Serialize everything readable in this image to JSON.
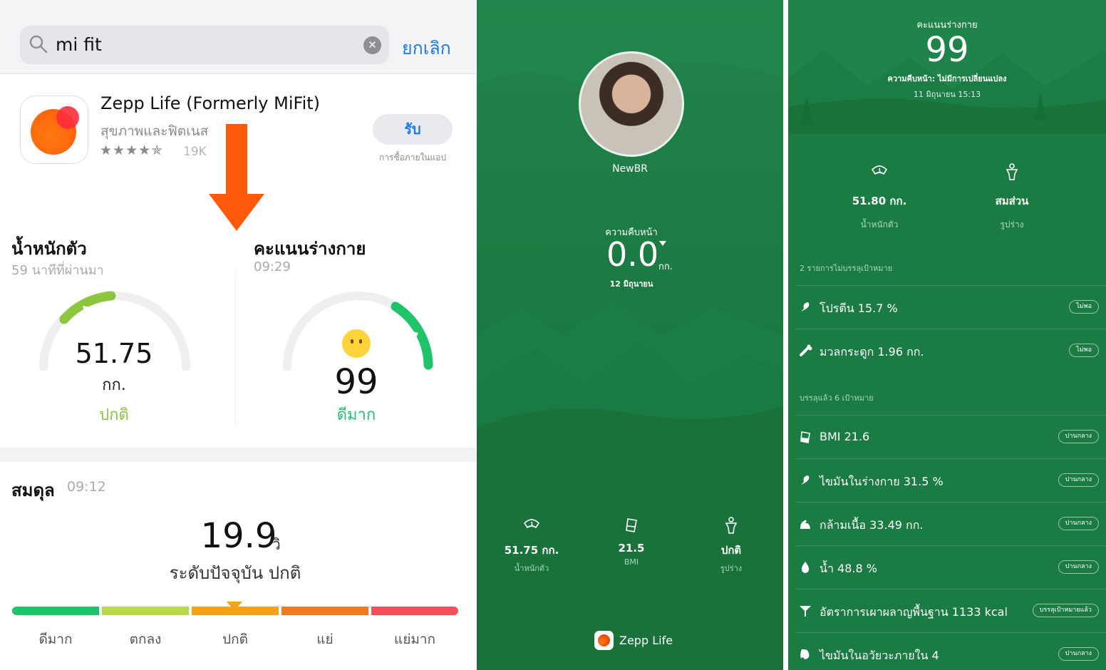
{
  "panel1": {
    "search": {
      "query": "mi fit",
      "cancel_label": "ยกเลิก"
    },
    "app": {
      "name": "Zepp Life (Formerly MiFit)",
      "category": "สุขภาพและฟิตเนส",
      "stars": "★★★★✯",
      "rating_count": "19K",
      "get_label": "รับ",
      "iap_note": "การซื้อภายในแอป",
      "rating_stars_value": 4.5
    },
    "weight_card": {
      "title": "น้ำหนักตัว",
      "time": "59 นาทีที่ผ่านมา",
      "value": "51.75",
      "unit": "กก.",
      "status": "ปกติ"
    },
    "score_card": {
      "title": "คะแนนร่างกาย",
      "time": "09:29",
      "value": "99",
      "status": "ดีมาก"
    },
    "balance": {
      "title": "สมดุล",
      "time": "09:12",
      "value": "19.9",
      "unit": "วิ",
      "level_text": "ระดับปัจจุบัน ปกติ",
      "scale_labels": [
        "ดีมาก",
        "ตกลง",
        "ปกติ",
        "แย่",
        "แย่มาก"
      ],
      "scale_colors": [
        "#1ec36a",
        "#b8d94a",
        "#f5a11c",
        "#f47a20",
        "#f2505a"
      ],
      "current_index": 2
    }
  },
  "panel2": {
    "username": "NewBR",
    "progress_label": "ความคืบหน้า",
    "progress_value": "0.0",
    "progress_unit": "กก.",
    "progress_date": "12 มิถุนายน",
    "stats": [
      {
        "value": "51.75 กก.",
        "label": "น้ำหนักตัว",
        "icon": "scale-icon"
      },
      {
        "value": "21.5",
        "label": "BMI",
        "icon": "bmi-icon"
      },
      {
        "value": "ปกติ",
        "label": "รูปร่าง",
        "icon": "body-icon"
      }
    ],
    "brand": "Zepp Life"
  },
  "panel3": {
    "score_label": "คะแนนร่างกาย",
    "score": "99",
    "progress_text": "ความคืบหน้า: ไม่มีการเปลี่ยนแปลง",
    "date": "11 มิถุนายน 15:13",
    "stats": [
      {
        "value": "51.80 กก.",
        "label": "น้ำหนักตัว",
        "icon": "scale-icon"
      },
      {
        "value": "สมส่วน",
        "label": "รูปร่าง",
        "icon": "body-icon"
      }
    ],
    "section_unmet": "2 รายการไม่บรรลุเป้าหมาย",
    "section_met": "บรรลุแล้ว 6 เป้าหมาย",
    "unmet_rows": [
      {
        "text": "โปรตีน 15.7 %",
        "tag": "ไม่พอ",
        "icon": "protein-icon"
      },
      {
        "text": "มวลกระดูก 1.96 กก.",
        "tag": "ไม่พอ",
        "icon": "bone-icon"
      }
    ],
    "met_rows": [
      {
        "text": "BMI 21.6",
        "tag": "ปานกลาง",
        "icon": "bmi-icon"
      },
      {
        "text": "ไขมันในร่างกาย 31.5 %",
        "tag": "ปานกลาง",
        "icon": "fat-icon"
      },
      {
        "text": "กล้ามเนื้อ 33.49 กก.",
        "tag": "ปานกลาง",
        "icon": "muscle-icon"
      },
      {
        "text": "น้ำ 48.8 %",
        "tag": "ปานกลาง",
        "icon": "water-icon"
      },
      {
        "text": "อัตราการเผาผลาญพื้นฐาน 1133 kcal",
        "tag": "บรรลุเป้าหมายแล้ว",
        "icon": "metabolism-icon"
      },
      {
        "text": "ไขมันในอวัยวะภายใน 4",
        "tag": "ปานกลาง",
        "icon": "visceral-fat-icon"
      }
    ]
  }
}
